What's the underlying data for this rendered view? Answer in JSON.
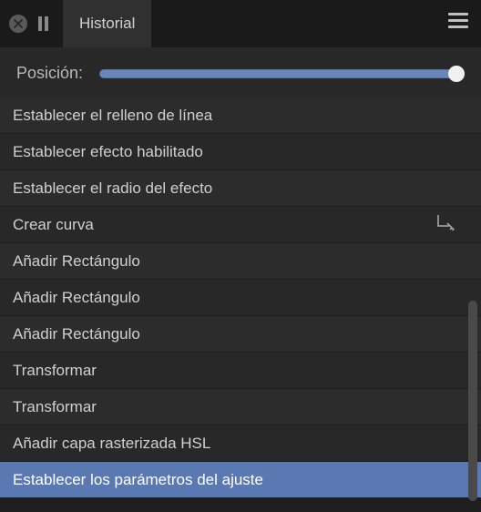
{
  "titlebar": {
    "tab_label": "Historial"
  },
  "position": {
    "label": "Posición:",
    "value": 100
  },
  "history": {
    "items": [
      {
        "label": "Establecer el relleno de línea",
        "icon": null,
        "selected": false
      },
      {
        "label": "Establecer efecto habilitado",
        "icon": null,
        "selected": false
      },
      {
        "label": "Establecer el radio del efecto",
        "icon": null,
        "selected": false
      },
      {
        "label": "Crear curva",
        "icon": "curve-icon",
        "selected": false
      },
      {
        "label": "Añadir Rectángulo",
        "icon": null,
        "selected": false
      },
      {
        "label": "Añadir Rectángulo",
        "icon": null,
        "selected": false
      },
      {
        "label": "Añadir Rectángulo",
        "icon": null,
        "selected": false
      },
      {
        "label": "Transformar",
        "icon": null,
        "selected": false
      },
      {
        "label": "Transformar",
        "icon": null,
        "selected": false
      },
      {
        "label": "Añadir capa rasterizada HSL",
        "icon": null,
        "selected": false
      },
      {
        "label": "Establecer los parámetros del ajuste",
        "icon": null,
        "selected": true
      }
    ]
  }
}
